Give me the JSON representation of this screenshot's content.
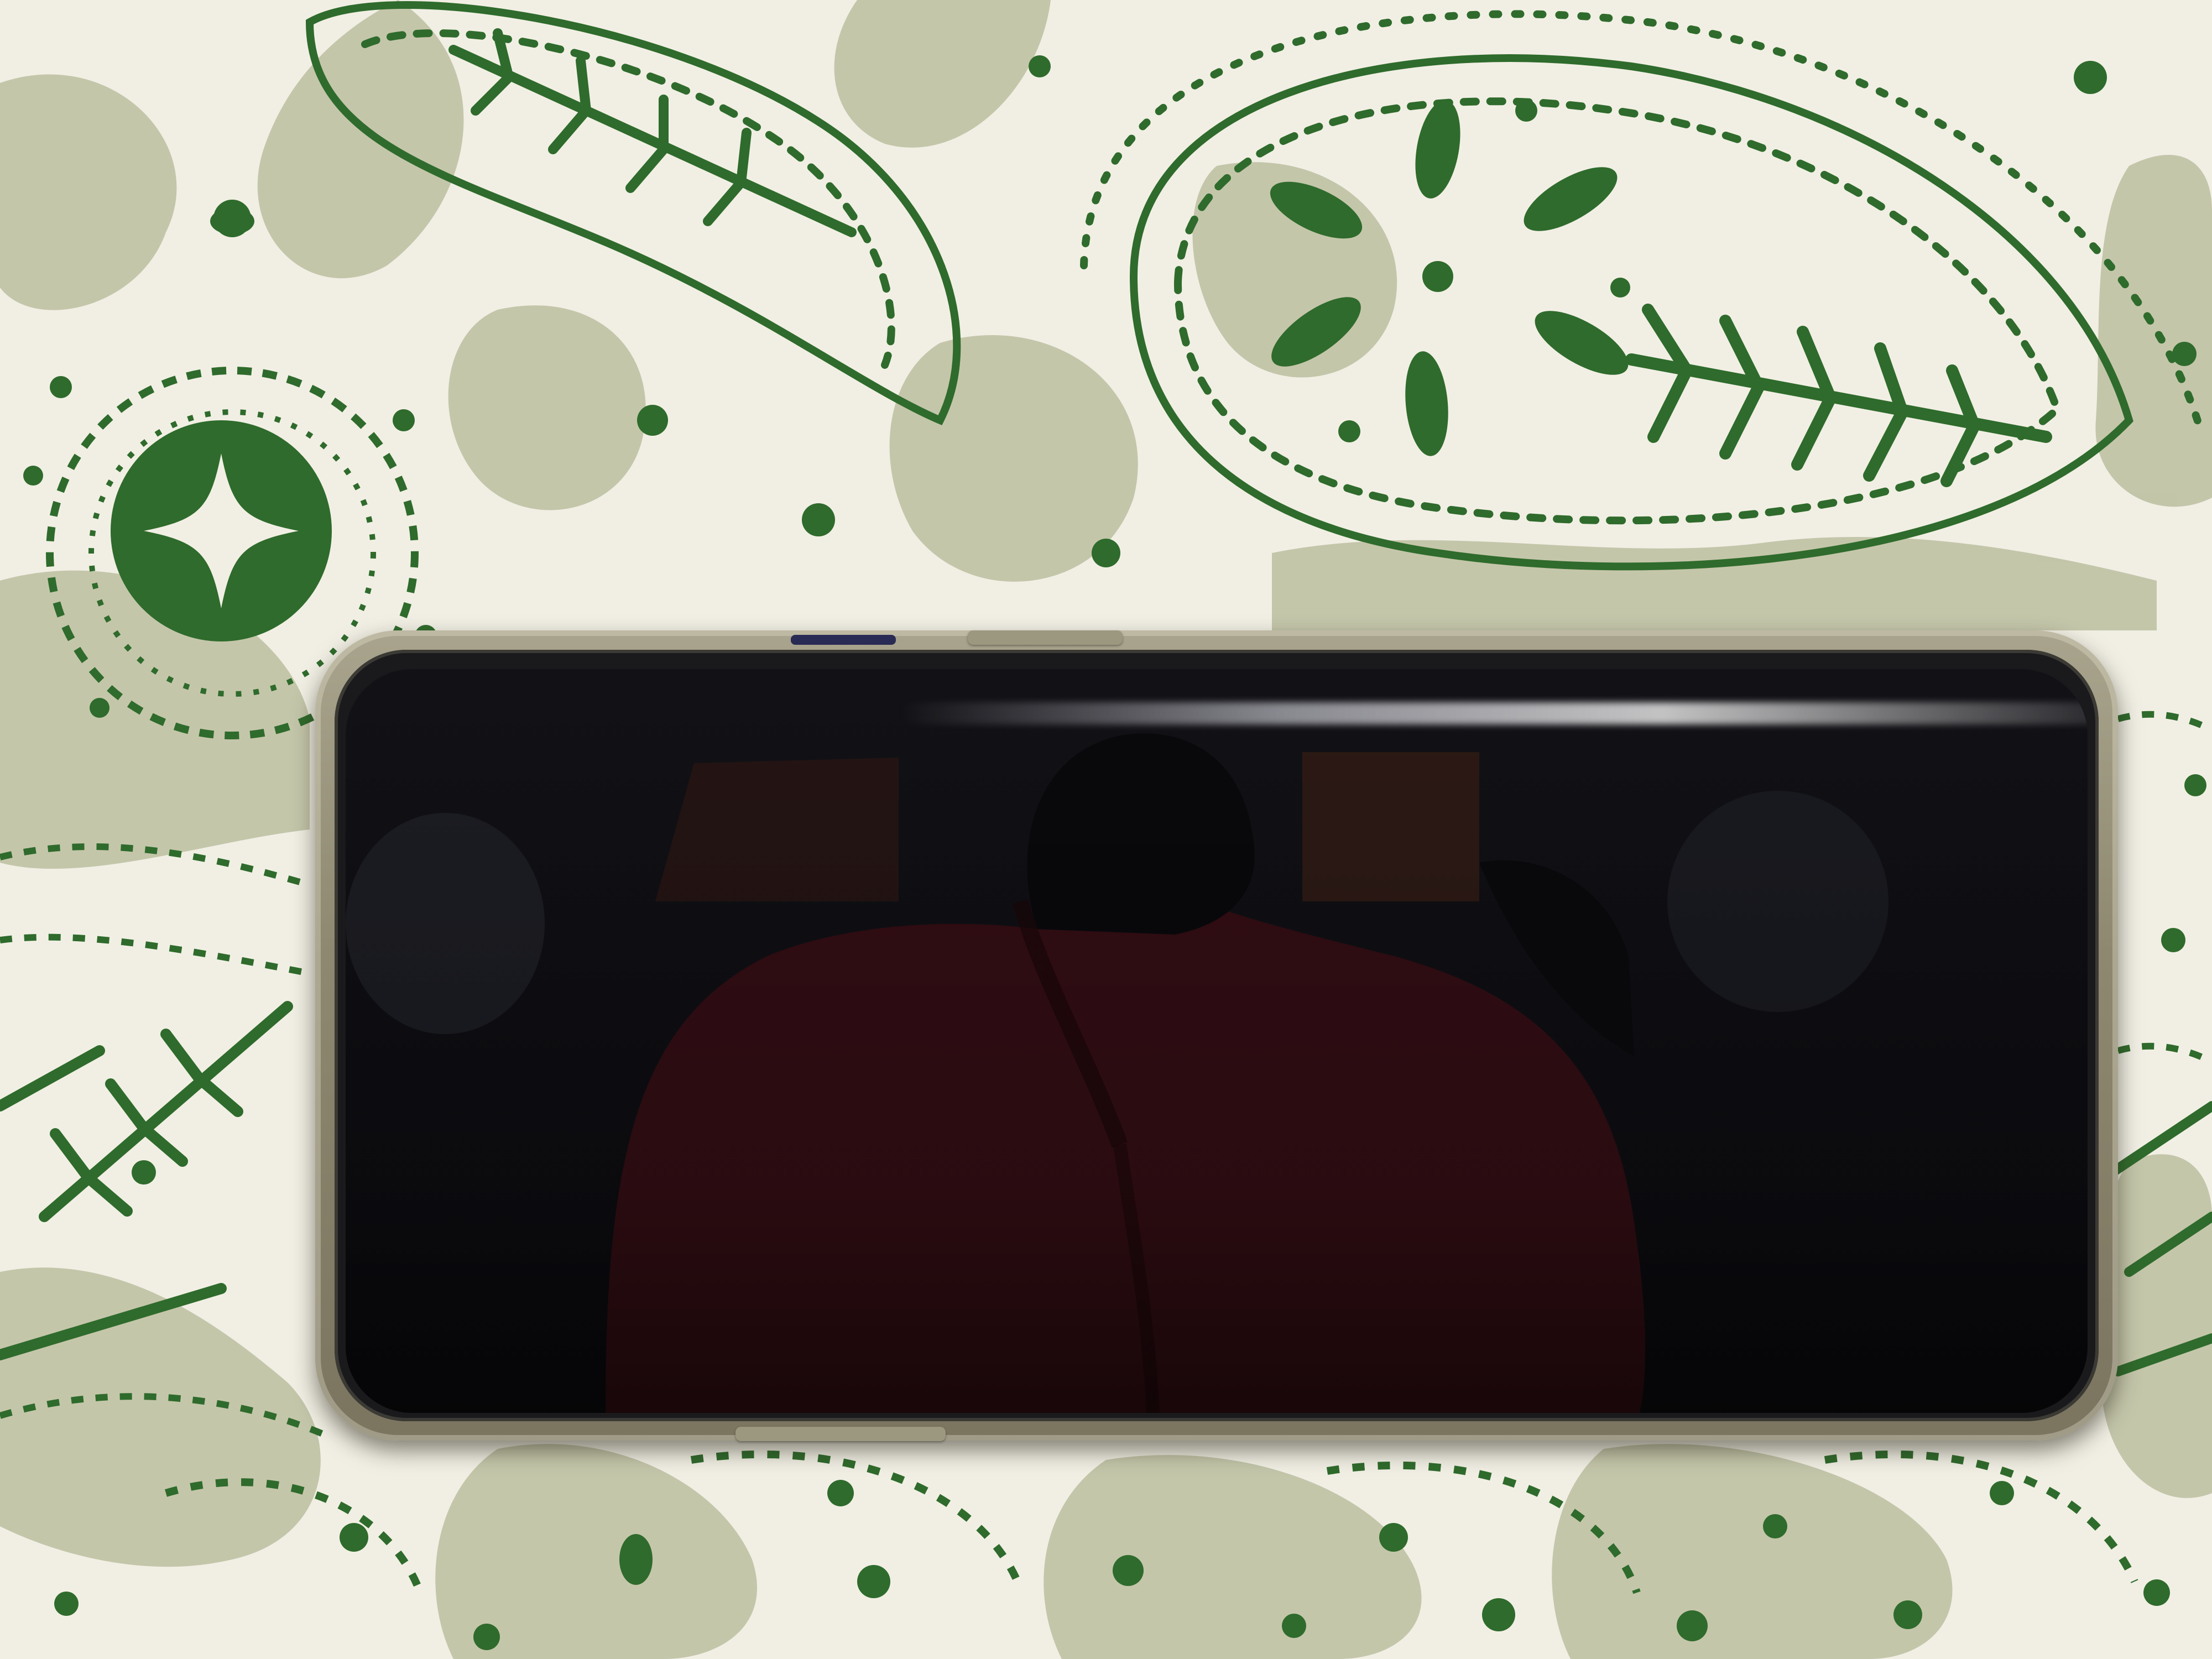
{
  "scene": {
    "colors": {
      "fabric_base": "#f1efe4",
      "fabric_sage": "#b9bb9c",
      "fabric_green": "#2f6b2c",
      "phone_case": "#8e8870",
      "screen": "#101015",
      "reflection_shirt": "#3a1016"
    },
    "objects": [
      "paisley-fabric",
      "smartphone",
      "screen-reflection"
    ]
  }
}
